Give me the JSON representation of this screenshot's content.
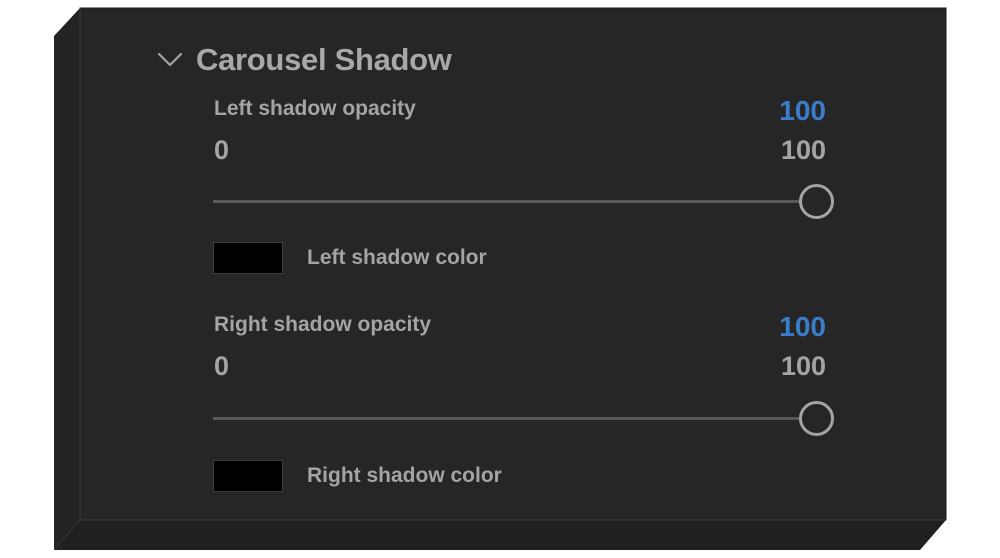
{
  "section": {
    "title": "Carousel Shadow",
    "expanded": true
  },
  "controls": [
    {
      "label": "Left shadow opacity",
      "value": "100",
      "min": "0",
      "max": "100",
      "fraction": 1.0
    },
    {
      "label": "Right shadow opacity",
      "value": "100",
      "min": "0",
      "max": "100",
      "fraction": 1.0
    }
  ],
  "colors": [
    {
      "label": "Left shadow color",
      "value": "#000000"
    },
    {
      "label": "Right shadow color",
      "value": "#000000"
    }
  ],
  "theme": {
    "panel_bg": "#262626",
    "accent": "#3a7dcc"
  }
}
